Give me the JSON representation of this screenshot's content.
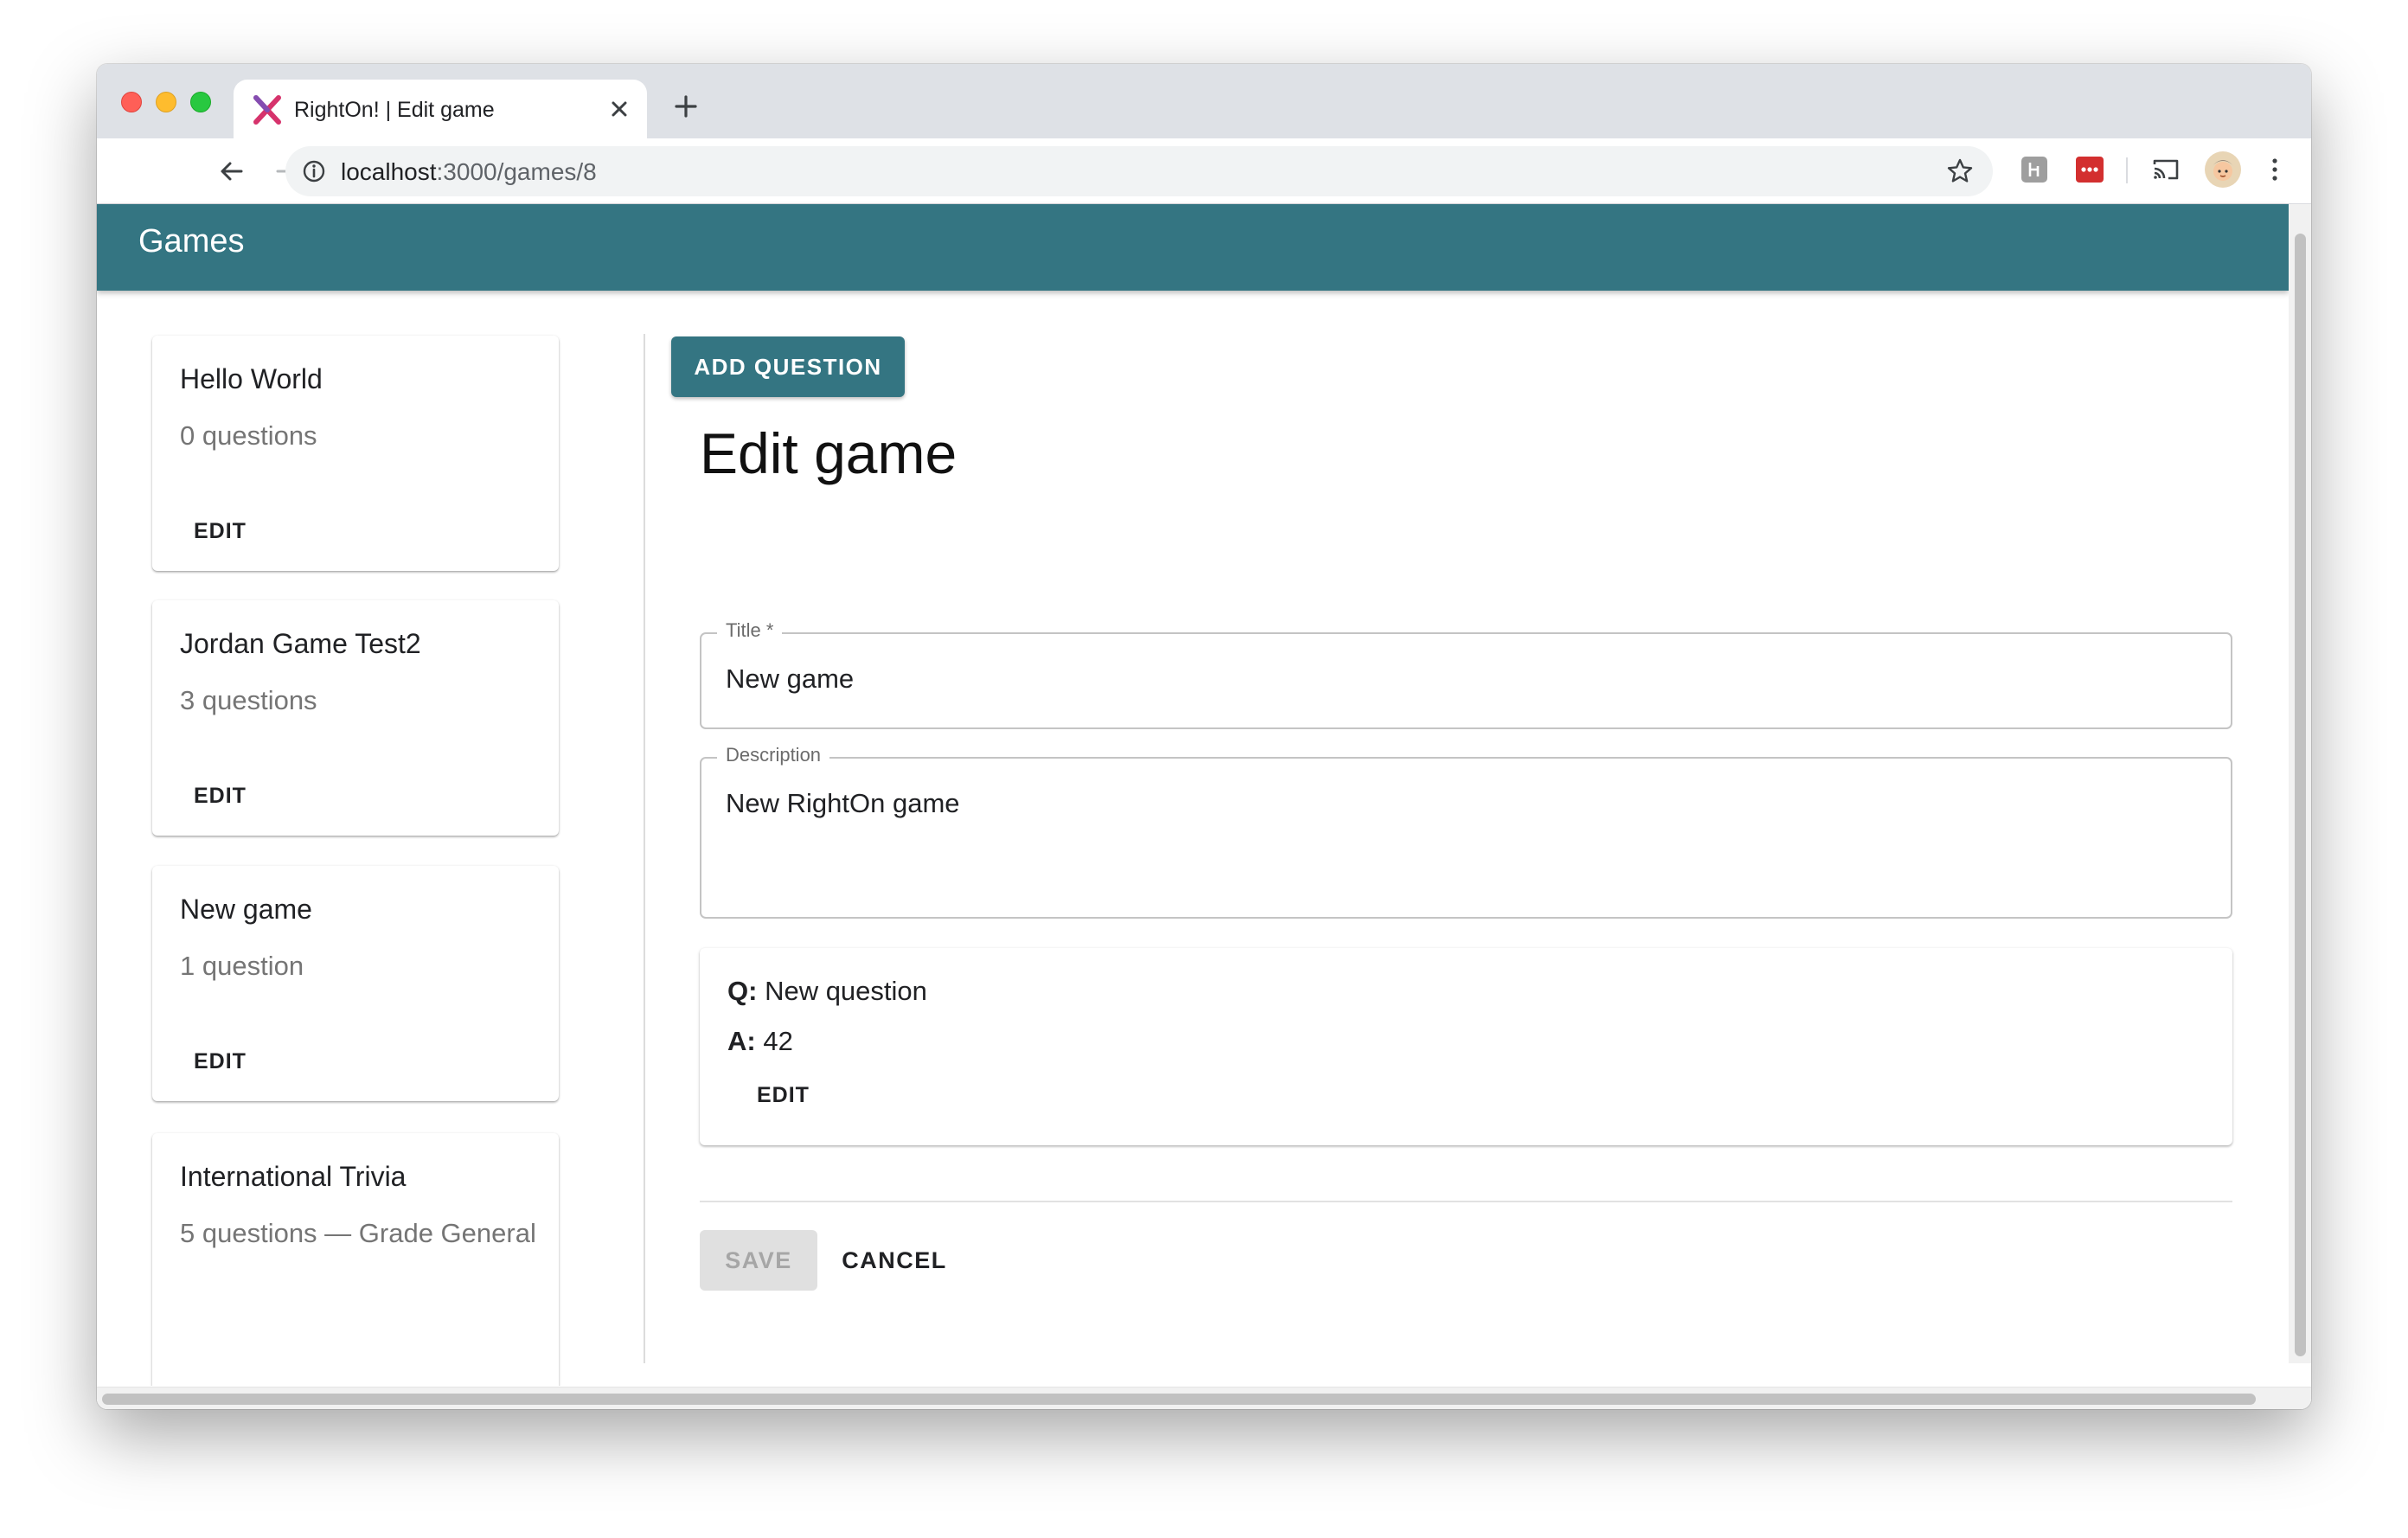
{
  "browser": {
    "tab_title": "RightOn! | Edit game",
    "url_host": "localhost",
    "url_path": ":3000/games/8"
  },
  "app": {
    "title": "Games",
    "accent_color": "#347582"
  },
  "games": [
    {
      "title": "Hello World",
      "subtitle": "0 questions",
      "edit_label": "EDIT"
    },
    {
      "title": "Jordan Game Test2",
      "subtitle": "3 questions",
      "edit_label": "EDIT"
    },
    {
      "title": "New game",
      "subtitle": "1 question",
      "edit_label": "EDIT"
    },
    {
      "title": "International Trivia",
      "subtitle": "5 questions — Grade General",
      "edit_label": ""
    }
  ],
  "editor": {
    "add_question_label": "ADD QUESTION",
    "heading": "Edit game",
    "title_field": {
      "label": "Title *",
      "value": "New game"
    },
    "description_field": {
      "label": "Description",
      "value": "New RightOn game"
    },
    "question": {
      "q_prefix": "Q:",
      "q_text": "New question",
      "a_prefix": "A:",
      "a_text": "42",
      "edit_label": "EDIT"
    },
    "save_label": "SAVE",
    "cancel_label": "CANCEL"
  }
}
